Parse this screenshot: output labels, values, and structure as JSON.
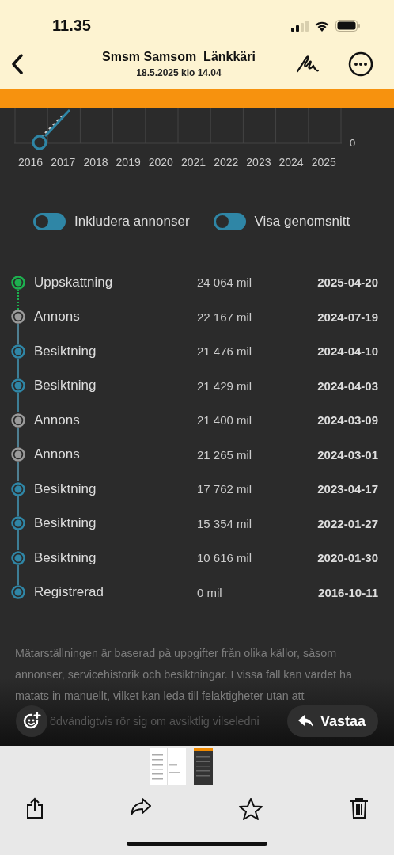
{
  "status_bar": {
    "time": "11.35"
  },
  "header": {
    "title": "Smsm Samsom  Länkkäri",
    "subtitle": "18.5.2025 klo 14.04"
  },
  "chart": {
    "x_labels": [
      "2016",
      "2017",
      "2018",
      "2019",
      "2020",
      "2021",
      "2022",
      "2023",
      "2024",
      "2025"
    ],
    "y_tick": "0"
  },
  "toggles": [
    {
      "label": "Inkludera annonser",
      "on": false
    },
    {
      "label": "Visa genomsnitt",
      "on": false
    }
  ],
  "timeline": [
    {
      "kind": "estimate",
      "label": "Uppskattning",
      "mileage": "24 064 mil",
      "date": "2025-04-20"
    },
    {
      "kind": "ad",
      "label": "Annons",
      "mileage": "22 167 mil",
      "date": "2024-07-19"
    },
    {
      "kind": "inspection",
      "label": "Besiktning",
      "mileage": "21 476 mil",
      "date": "2024-04-10"
    },
    {
      "kind": "inspection",
      "label": "Besiktning",
      "mileage": "21 429 mil",
      "date": "2024-04-03"
    },
    {
      "kind": "ad",
      "label": "Annons",
      "mileage": "21 400 mil",
      "date": "2024-03-09"
    },
    {
      "kind": "ad",
      "label": "Annons",
      "mileage": "21 265 mil",
      "date": "2024-03-01"
    },
    {
      "kind": "inspection",
      "label": "Besiktning",
      "mileage": "17 762 mil",
      "date": "2023-04-17"
    },
    {
      "kind": "inspection",
      "label": "Besiktning",
      "mileage": "15 354 mil",
      "date": "2022-01-27"
    },
    {
      "kind": "inspection",
      "label": "Besiktning",
      "mileage": "10 616 mil",
      "date": "2020-01-30"
    },
    {
      "kind": "inspection",
      "label": "Registrerad",
      "mileage": "0 mil",
      "date": "2016-10-11"
    }
  ],
  "disclaimer": "Mätarställningen är baserad på uppgifter från olika källor, såsom annonser, servicehistorik och besiktningar. I vissa fall kan värdet ha matats in manuellt, vilket kan leda till felaktigheter utan att",
  "disclaimer_fragment": "ödvändigtvis rör sig om avsiktlig vilseledni",
  "reply_button": "Vastaa"
}
